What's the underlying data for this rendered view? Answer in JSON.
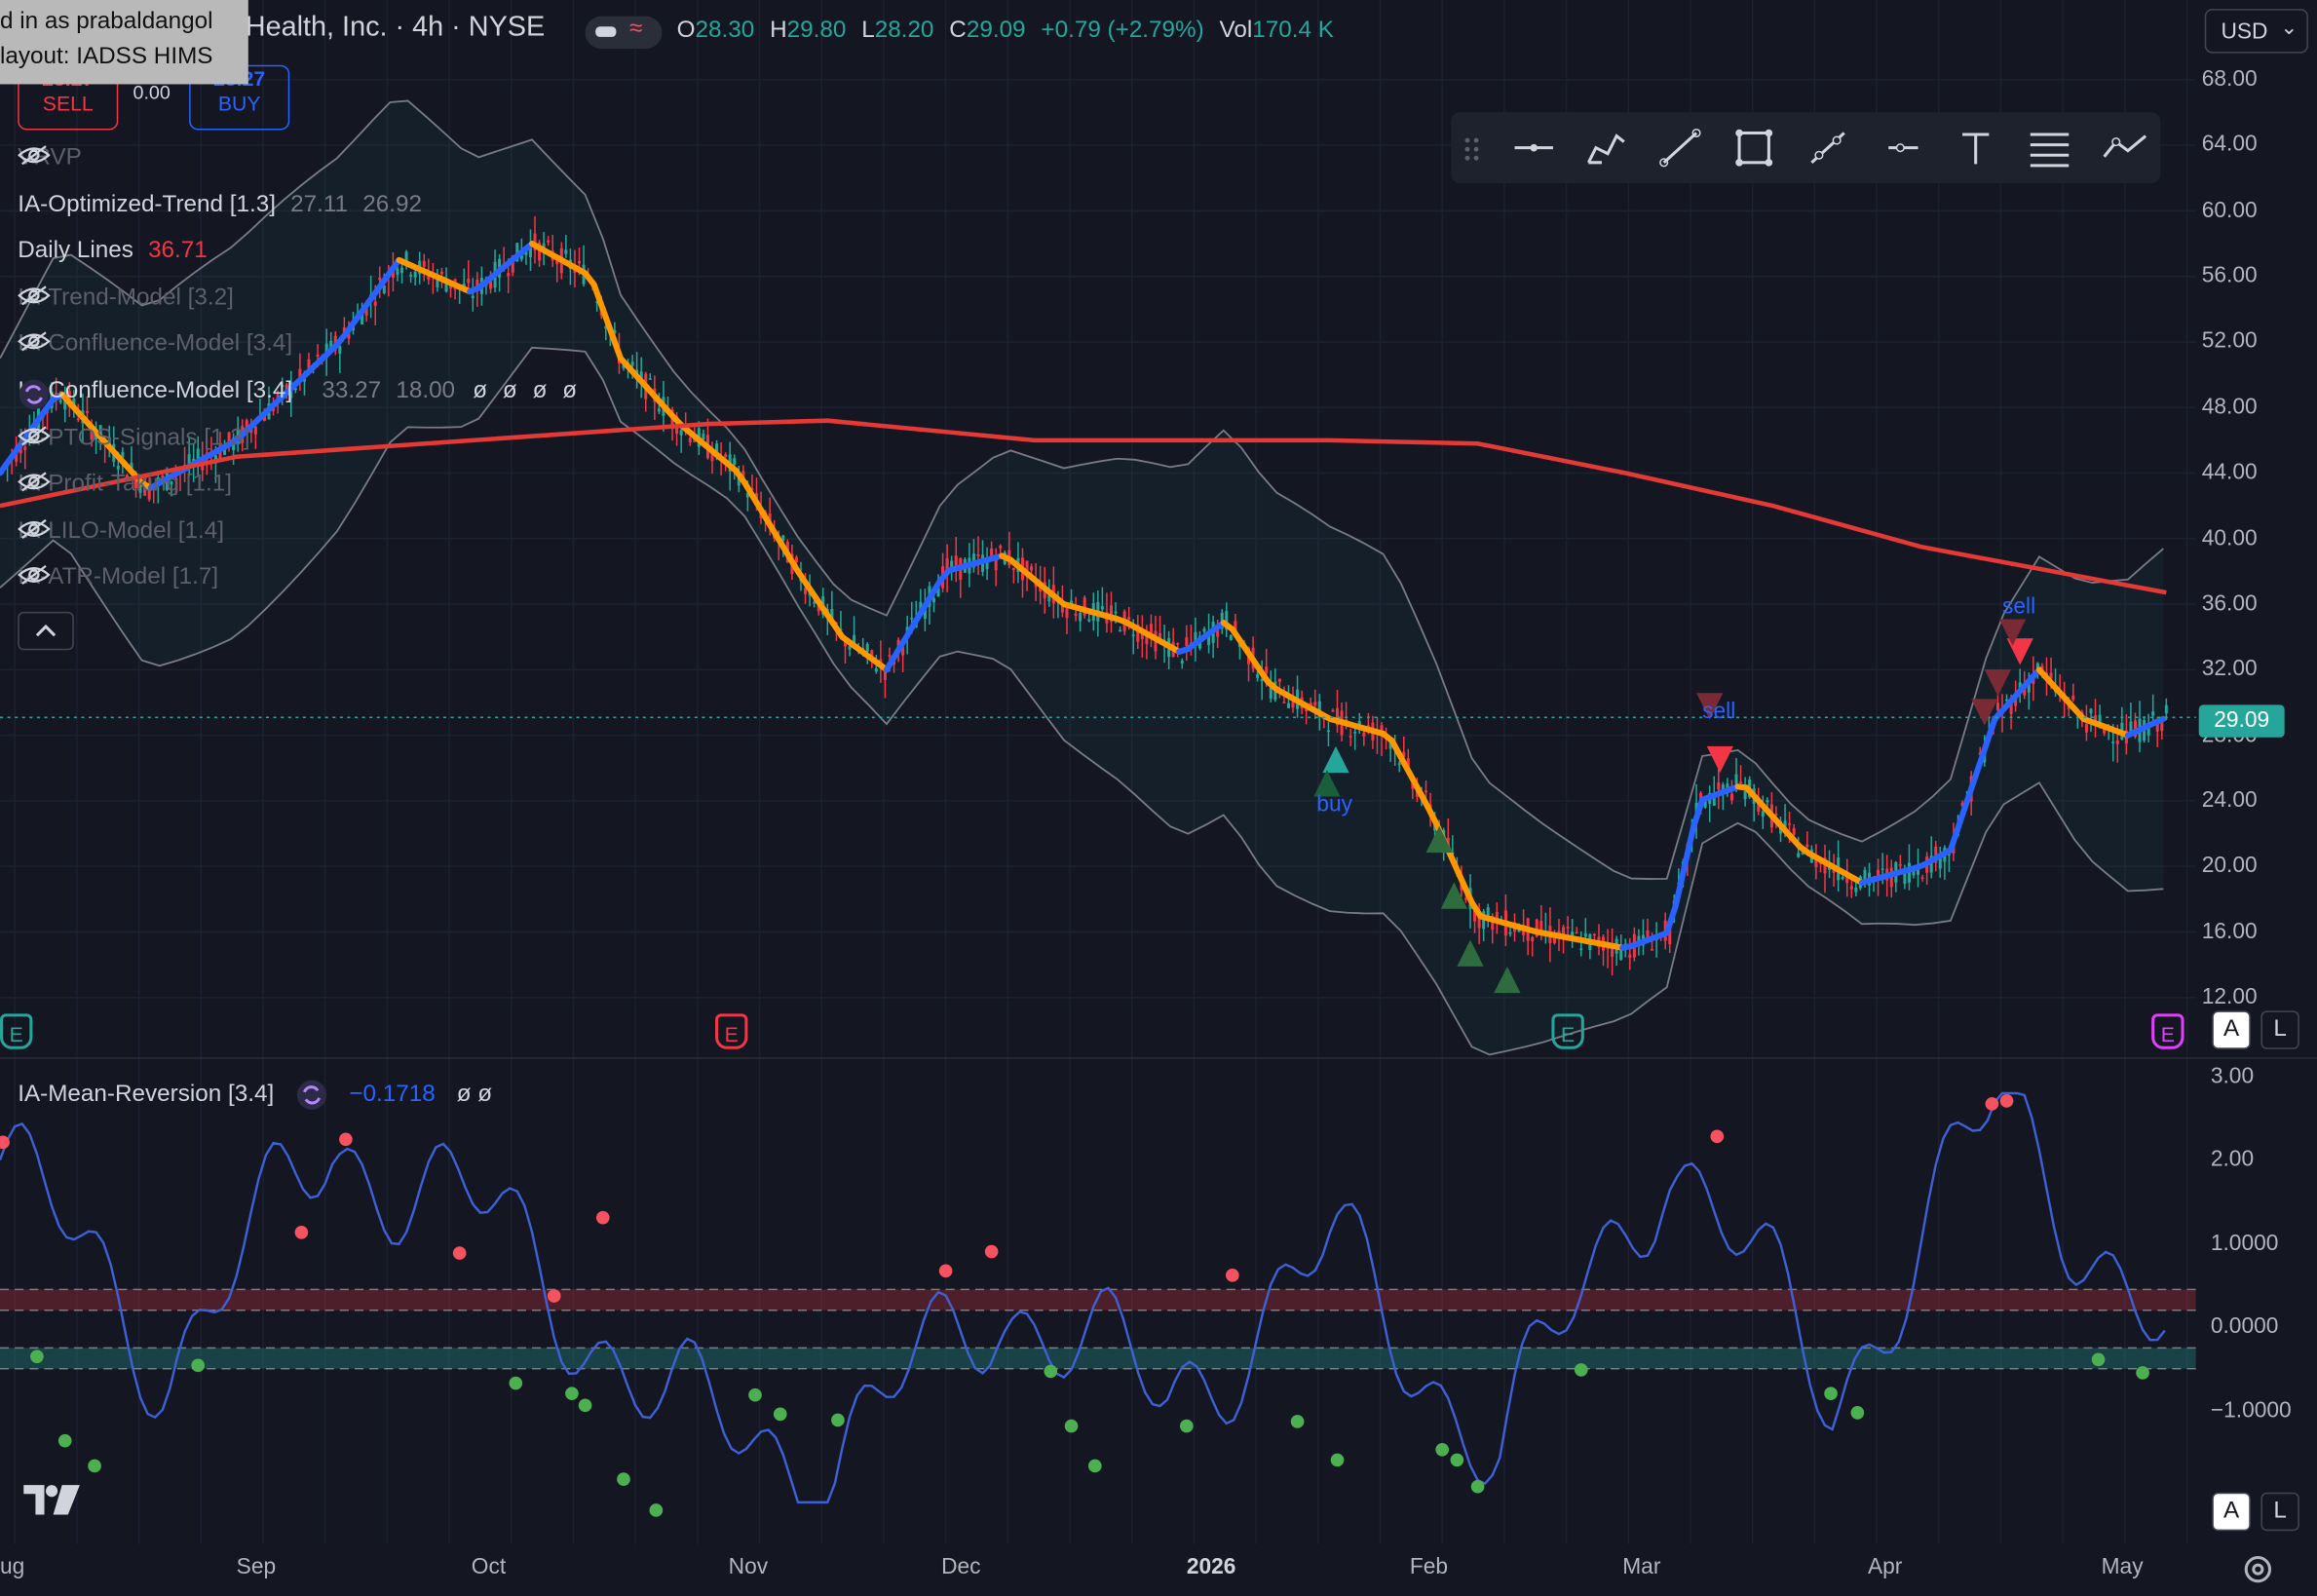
{
  "header": {
    "symbol": "Health, Inc. · 4h · NYSE",
    "ohlc": {
      "o_label": "O",
      "o": "28.30",
      "h_label": "H",
      "h": "29.80",
      "l_label": "L",
      "l": "28.20",
      "c_label": "C",
      "c": "29.09",
      "change": "+0.79 (+2.79%)",
      "vol_label": "Vol",
      "vol": "170.4 K"
    },
    "currency": "USD",
    "currency_chevron": "⌄"
  },
  "tooltip": {
    "line1": "d in as prabaldangol",
    "line2": "layout: IADSS HIMS"
  },
  "trade": {
    "sell_price": "28.27",
    "sell_label": "SELL",
    "spread": "0.00",
    "buy_price": "28.27",
    "buy_label": "BUY"
  },
  "indicators": [
    {
      "name": "VRVP",
      "value": "",
      "value2": "",
      "extra": "",
      "hidden": true
    },
    {
      "name": "IA-Optimized-Trend [1.3]",
      "value": "27.11",
      "value2": "26.92",
      "extra": "",
      "hidden": false
    },
    {
      "name": "Daily Lines",
      "value": "36.71",
      "value2": "",
      "extra": "",
      "hidden": false
    },
    {
      "name": "IA-Trend-Model [3.2]",
      "value": "",
      "value2": "",
      "extra": "",
      "hidden": true
    },
    {
      "name": "IA-Confluence-Model [3.4]",
      "value": "",
      "value2": "",
      "extra": "",
      "hidden": true
    },
    {
      "name": "IA-Confluence-Model [3.4]",
      "value": "33.27",
      "value2": "18.00",
      "extra": "ø ø ø ø",
      "hidden": false
    },
    {
      "name": "IA-PTOS-Signals [1.3]",
      "value": "",
      "value2": "",
      "extra": "",
      "hidden": true
    },
    {
      "name": "IA-Profit-Taking [1.1]",
      "value": "",
      "value2": "",
      "extra": "",
      "hidden": true
    },
    {
      "name": "IA-LILO-Model [1.4]",
      "value": "",
      "value2": "",
      "extra": "",
      "hidden": true
    },
    {
      "name": "IA-ATR-Model [1.7]",
      "value": "",
      "value2": "",
      "extra": "",
      "hidden": true
    }
  ],
  "oscillator": {
    "name": "IA-Mean-Reversion [3.4]",
    "value": "−0.1718",
    "extra": "ø ø"
  },
  "price_axis": [
    "68.00",
    "64.00",
    "60.00",
    "56.00",
    "52.00",
    "48.00",
    "44.00",
    "40.00",
    "36.00",
    "32.00",
    "28.00",
    "24.00",
    "20.00",
    "16.00",
    "12.00"
  ],
  "osc_axis": [
    "3.00",
    "2.00",
    "1.0000",
    "0.0000",
    "−1.0000"
  ],
  "time_axis": [
    "ug",
    "Sep",
    "Oct",
    "Nov",
    "Dec",
    "2026",
    "Feb",
    "Mar",
    "Apr",
    "May"
  ],
  "last_price": "29.09",
  "signals": {
    "buy": "buy",
    "sell1": "sell",
    "sell2": "sell"
  },
  "earnings_marker": "E",
  "scale_buttons": {
    "auto": "A",
    "log": "L"
  },
  "logo": "TV",
  "colors": {
    "background": "#141722",
    "up": "#26a69a",
    "down": "#f23645",
    "trend_blue": "#2962ff",
    "trend_orange": "#ff9800",
    "daily_line": "#e53935",
    "osc_line": "#3f5fd6"
  },
  "chart_data": {
    "type": "line",
    "title": "",
    "x": [
      "Aug",
      "Sep",
      "Oct",
      "Nov",
      "Dec",
      "2026",
      "Feb",
      "Mar",
      "Apr",
      "May"
    ],
    "series": [
      {
        "name": "",
        "values": [
          44,
          56,
          57,
          44,
          38,
          34,
          27,
          16,
          20,
          29.09
        ]
      },
      {
        "name": "",
        "values": [
          42,
          45,
          47,
          47,
          46,
          46,
          46,
          44,
          40,
          36.71
        ]
      }
    ],
    "ylim": [
      12,
      68
    ],
    "oscillator": {
      "values": [
        2.0,
        -0.4,
        2.2,
        1.2,
        -1.0,
        -1.6,
        0.4,
        -0.9,
        0.9,
        -1.5,
        2.2,
        -0.8,
        2.7,
        -0.2
      ],
      "ylim": [
        -2.2,
        3.0
      ]
    }
  }
}
